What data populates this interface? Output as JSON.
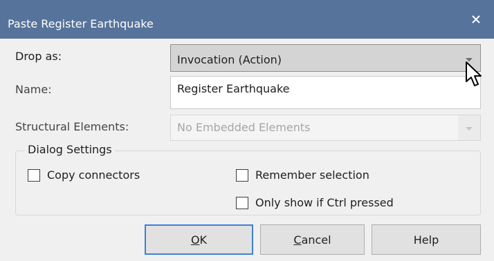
{
  "window": {
    "title": "Paste Register Earthquake",
    "close_icon": "close-icon",
    "titlebar_color": "#56739b"
  },
  "drop_as": {
    "label": "Drop as:",
    "value": "Invocation (Action)"
  },
  "name": {
    "label": "Name:",
    "value": "Register Earthquake"
  },
  "structural": {
    "label": "Structural Elements:",
    "value": "No Embedded Elements"
  },
  "settings": {
    "title": "Dialog Settings",
    "copy_connectors": {
      "label": "Copy connectors",
      "checked": false
    },
    "remember_selection": {
      "label": "Remember selection",
      "checked": false
    },
    "only_show_ctrl": {
      "label": "Only show if Ctrl pressed",
      "checked": false
    }
  },
  "buttons": {
    "ok": {
      "mnemonic": "O",
      "rest": "K"
    },
    "cancel": {
      "mnemonic": "C",
      "rest": "ancel"
    },
    "help": "Help",
    "default_border_color": "#3d80d8"
  },
  "cursor_icon": "mouse-pointer-icon"
}
